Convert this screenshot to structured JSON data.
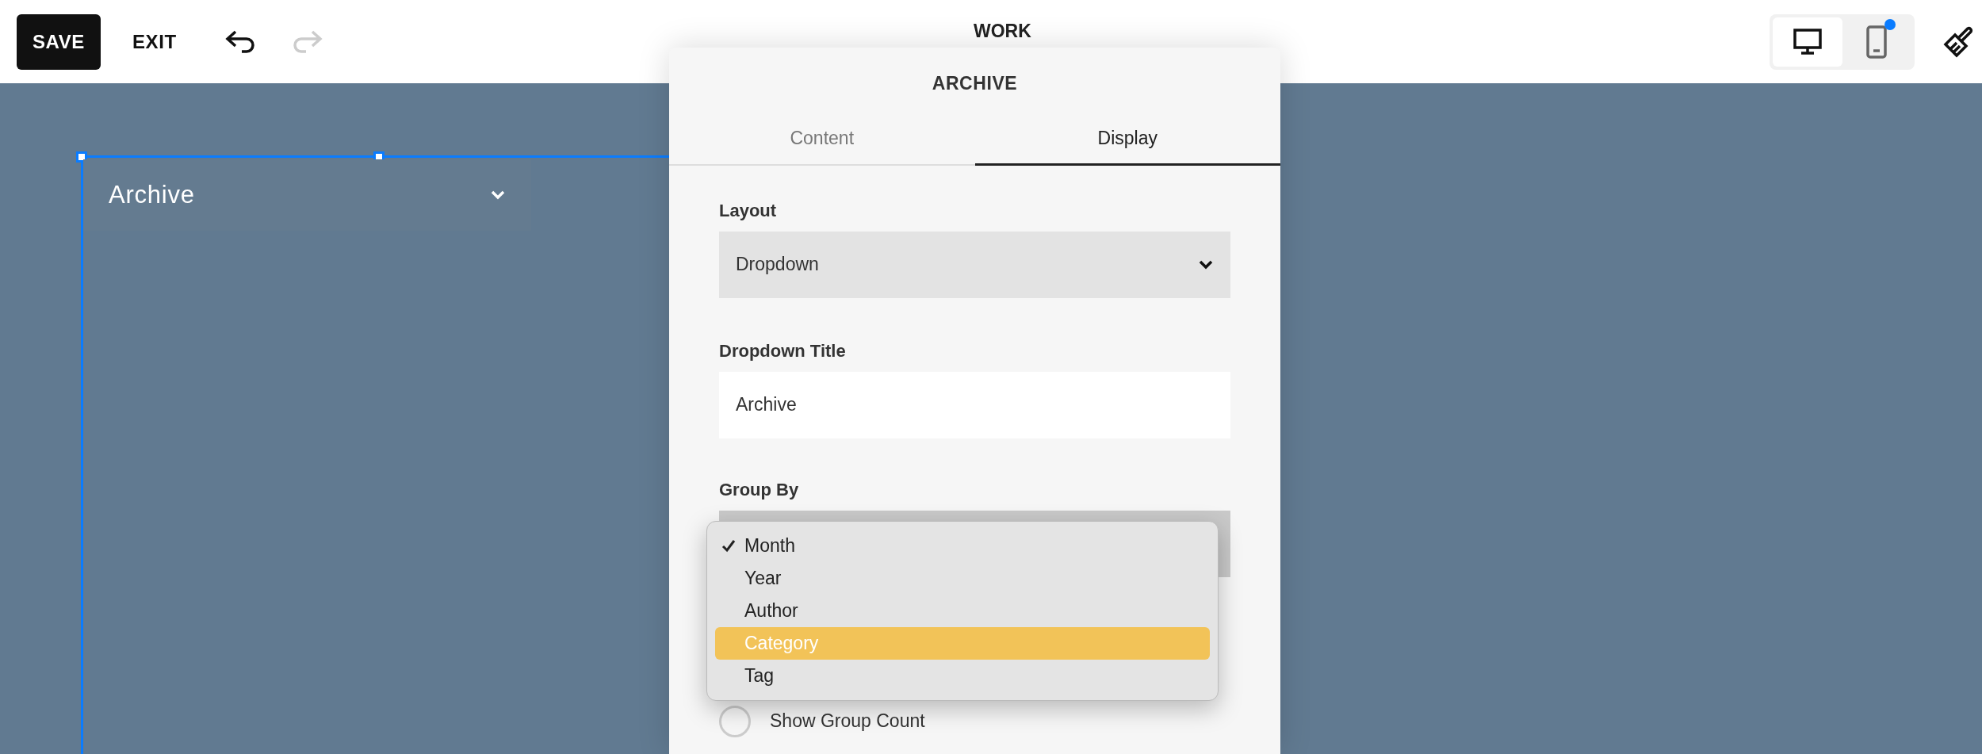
{
  "toolbar": {
    "save": "SAVE",
    "exit": "EXIT",
    "undo_enabled": true,
    "redo_enabled": false,
    "page_title": "WORK",
    "devices": [
      {
        "kind": "desktop",
        "selected": true,
        "badge": false
      },
      {
        "kind": "mobile",
        "selected": false,
        "badge": true
      }
    ]
  },
  "canvas": {
    "block_title": "Archive"
  },
  "panel": {
    "title": "ARCHIVE",
    "tabs": [
      {
        "label": "Content",
        "selected": false
      },
      {
        "label": "Display",
        "selected": true
      }
    ],
    "fields": [
      {
        "kind": "select",
        "label": "Layout",
        "value": "Dropdown"
      },
      {
        "kind": "text",
        "label": "Dropdown Title",
        "value": "Archive"
      },
      {
        "kind": "menu",
        "label": "Group By",
        "options": [
          {
            "label": "Month",
            "checked": true,
            "selected": false
          },
          {
            "label": "Year",
            "checked": false,
            "selected": false
          },
          {
            "label": "Author",
            "checked": false,
            "selected": false
          },
          {
            "label": "Category",
            "checked": false,
            "selected": true
          },
          {
            "label": "Tag",
            "checked": false,
            "selected": false
          }
        ]
      },
      {
        "kind": "toggle",
        "label": "Show Group Count",
        "on": false
      }
    ]
  }
}
